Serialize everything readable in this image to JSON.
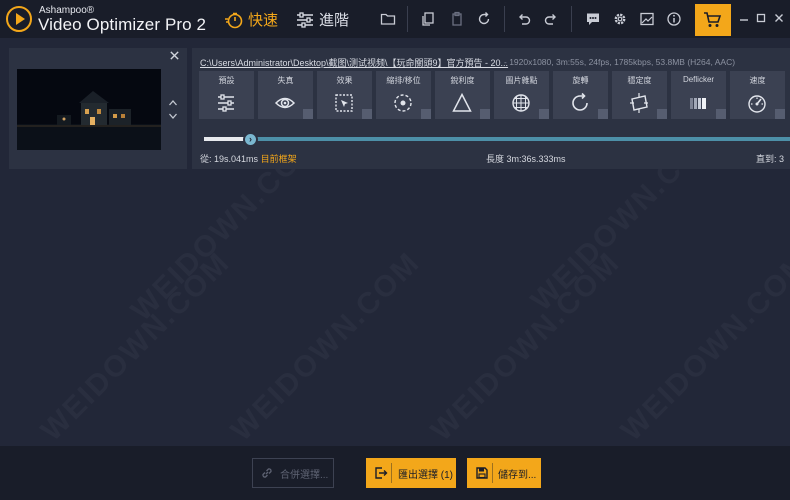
{
  "app": {
    "brand_top": "Ashampoo®",
    "brand_name": "Video Optimizer Pro 2"
  },
  "modes": {
    "fast": "快速",
    "advanced": "進階"
  },
  "clip": {
    "file_path": "C:\\Users\\Administrator\\Desktop\\截图\\测试视频\\【玩命關頭9】官方預告 - 20...",
    "file_info": "-   1920x1080, 3m:55s, 24fps, 1785kbps, 53.8MB (H264, AAC)"
  },
  "tools": [
    {
      "label": "預設",
      "icon": "sliders-icon"
    },
    {
      "label": "失真",
      "icon": "eye-icon"
    },
    {
      "label": "效果",
      "icon": "effects-icon"
    },
    {
      "label": "縮排/移位",
      "icon": "target-icon"
    },
    {
      "label": "銳利度",
      "icon": "triangle-icon"
    },
    {
      "label": "圖片雜點",
      "icon": "grid-sphere-icon"
    },
    {
      "label": "旋轉",
      "icon": "rotate-icon"
    },
    {
      "label": "穩定度",
      "icon": "stabilize-icon"
    },
    {
      "label": "Deflicker",
      "icon": "deflicker-icon"
    },
    {
      "label": "速度",
      "icon": "speedometer-icon"
    }
  ],
  "timeline": {
    "progress_fraction": 0.08,
    "from_label": "從:",
    "from_value": "19s.041ms",
    "current_frame_label": "目前框架",
    "length_label": "長度",
    "length_value": "3m:36s.333ms",
    "to_label": "直到:",
    "to_value": "3"
  },
  "bottom": {
    "merge": "合併選擇...",
    "export": "匯出選擇 (1)",
    "save": "儲存到..."
  },
  "watermark": "WEIDOWN.COM",
  "colors": {
    "accent": "#f3a71a",
    "background": "#222738",
    "panel": "#2c3242",
    "progress": "#4d90a8"
  }
}
